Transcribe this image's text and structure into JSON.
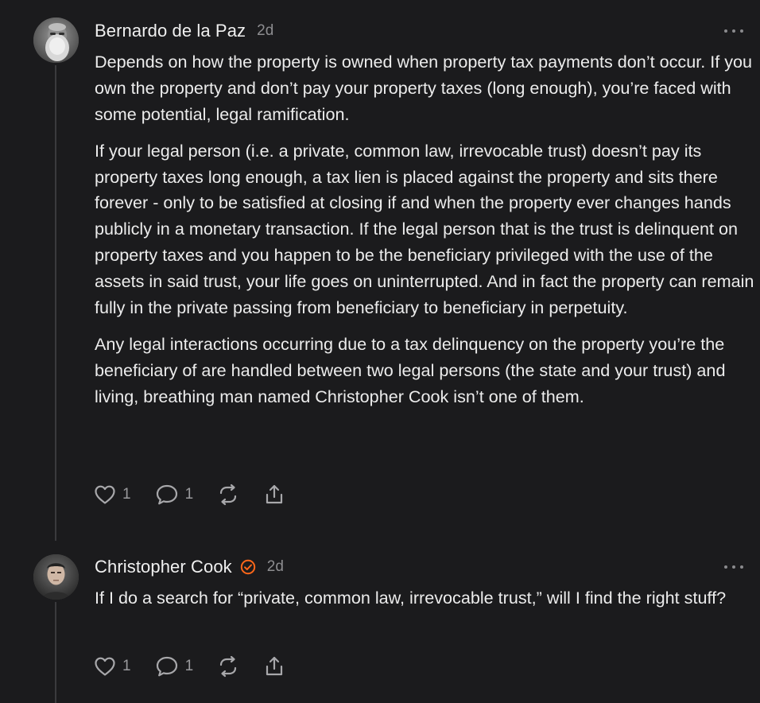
{
  "comments": [
    {
      "author": "Bernardo de la Paz",
      "time": "2d",
      "verified": false,
      "avatar_icon": "avatar-bearded-man",
      "paragraphs": [
        "Depends on how the property is owned when property tax payments don’t occur. If you own the property and don’t pay your property taxes (long enough), you’re faced with some potential, legal ramification.",
        "If your legal person (i.e. a private, common law, irrevocable trust) doesn’t pay its property taxes long enough, a tax lien is placed against the property and sits there forever - only to be satisfied at closing if and when the property ever changes hands publicly in a monetary transaction. If the legal person that is the trust is delinquent on property taxes and you happen to be the beneficiary privileged with the use of the assets in said trust, your life goes on uninterrupted. And in fact the property can remain fully in the private passing from beneficiary to beneficiary in perpetuity.",
        "Any legal interactions occurring due to a tax delinquency on the property you’re the beneficiary of are handled between two legal persons (the state and your trust) and living, breathing man named Christopher Cook isn’t one of them."
      ],
      "likes": "1",
      "replies": "1"
    },
    {
      "author": "Christopher Cook",
      "time": "2d",
      "verified": true,
      "avatar_icon": "avatar-man-portrait",
      "paragraphs": [
        "If I do a search for “private, common law, irrevocable trust,” will I find the right stuff?"
      ],
      "likes": "1",
      "replies": "1"
    }
  ],
  "colors": {
    "background": "#1b1b1d",
    "text": "#ececec",
    "muted": "#8d8d90",
    "verified_accent": "#ff6719",
    "thread_line": "#3a3a3d"
  },
  "icons": [
    "heart-icon",
    "comment-icon",
    "restack-icon",
    "share-icon",
    "more-icon",
    "verified-icon"
  ]
}
